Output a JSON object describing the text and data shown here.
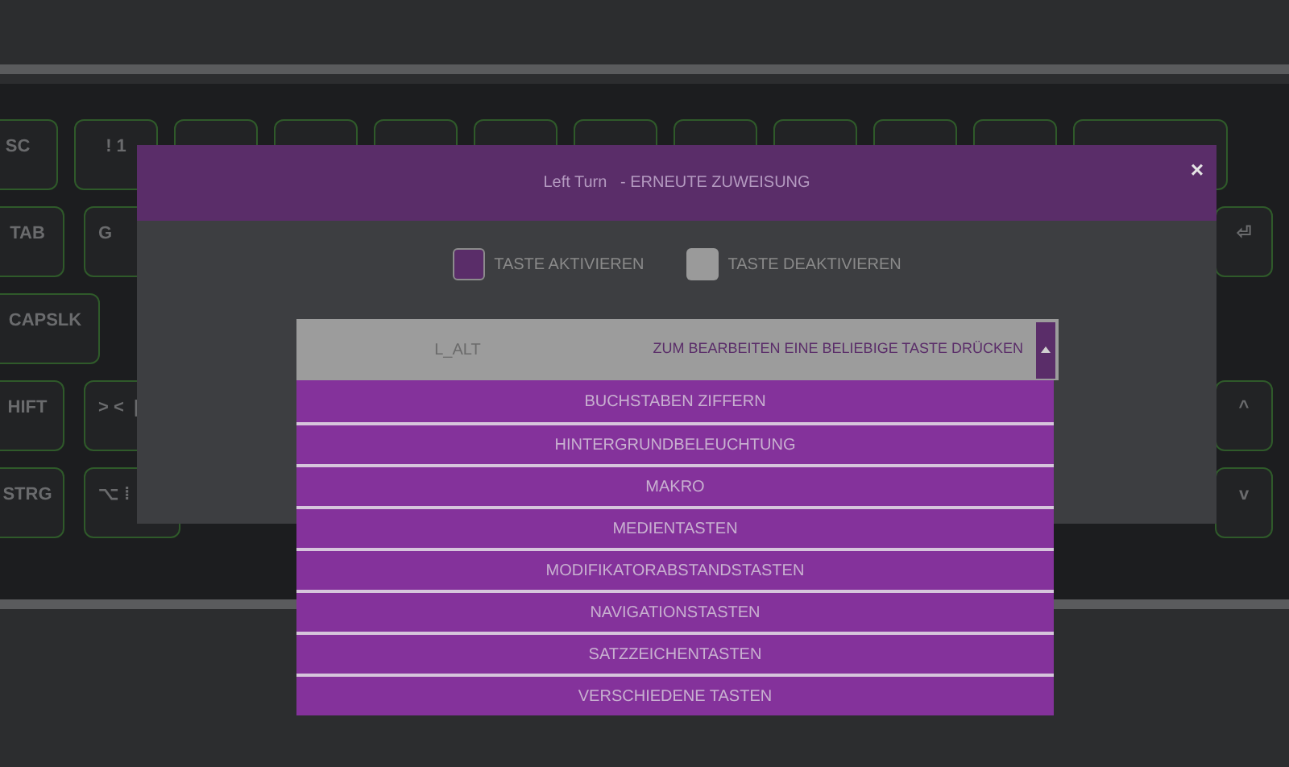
{
  "keyboard": {
    "top_row": [
      "SC",
      "! 1"
    ],
    "rows": [
      {
        "left": [
          "TAB",
          "G"
        ],
        "right": "⏎"
      },
      {
        "left": [
          "CAPSLK"
        ],
        "right": ""
      },
      {
        "left": [
          "HIFT",
          "> <  |"
        ],
        "right": "^"
      },
      {
        "left": [
          "STRG",
          "⌥ ⁞"
        ],
        "right": "v"
      }
    ]
  },
  "dialog": {
    "title": "Left Turn   - ERNEUTE ZUWEISUNG",
    "close": "×",
    "options": [
      {
        "label": "TASTE AKTIVIEREN",
        "selected": true
      },
      {
        "label": "TASTE DEAKTIVIEREN",
        "selected": false
      }
    ],
    "dropdown": {
      "value": "L_ALT",
      "hint": "ZUM BEARBEITEN EINE BELIEBIGE TASTE DRÜCKEN",
      "expanded": true,
      "items": [
        "BUCHSTABEN ZIFFERN",
        "HINTERGRUNDBELEUCHTUNG",
        "MAKRO",
        "MEDIENTASTEN",
        "MODIFIKATORABSTANDSTASTEN",
        "NAVIGATIONSTASTEN",
        "SATZZEICHENTASTEN",
        "VERSCHIEDENE TASTEN"
      ]
    }
  }
}
